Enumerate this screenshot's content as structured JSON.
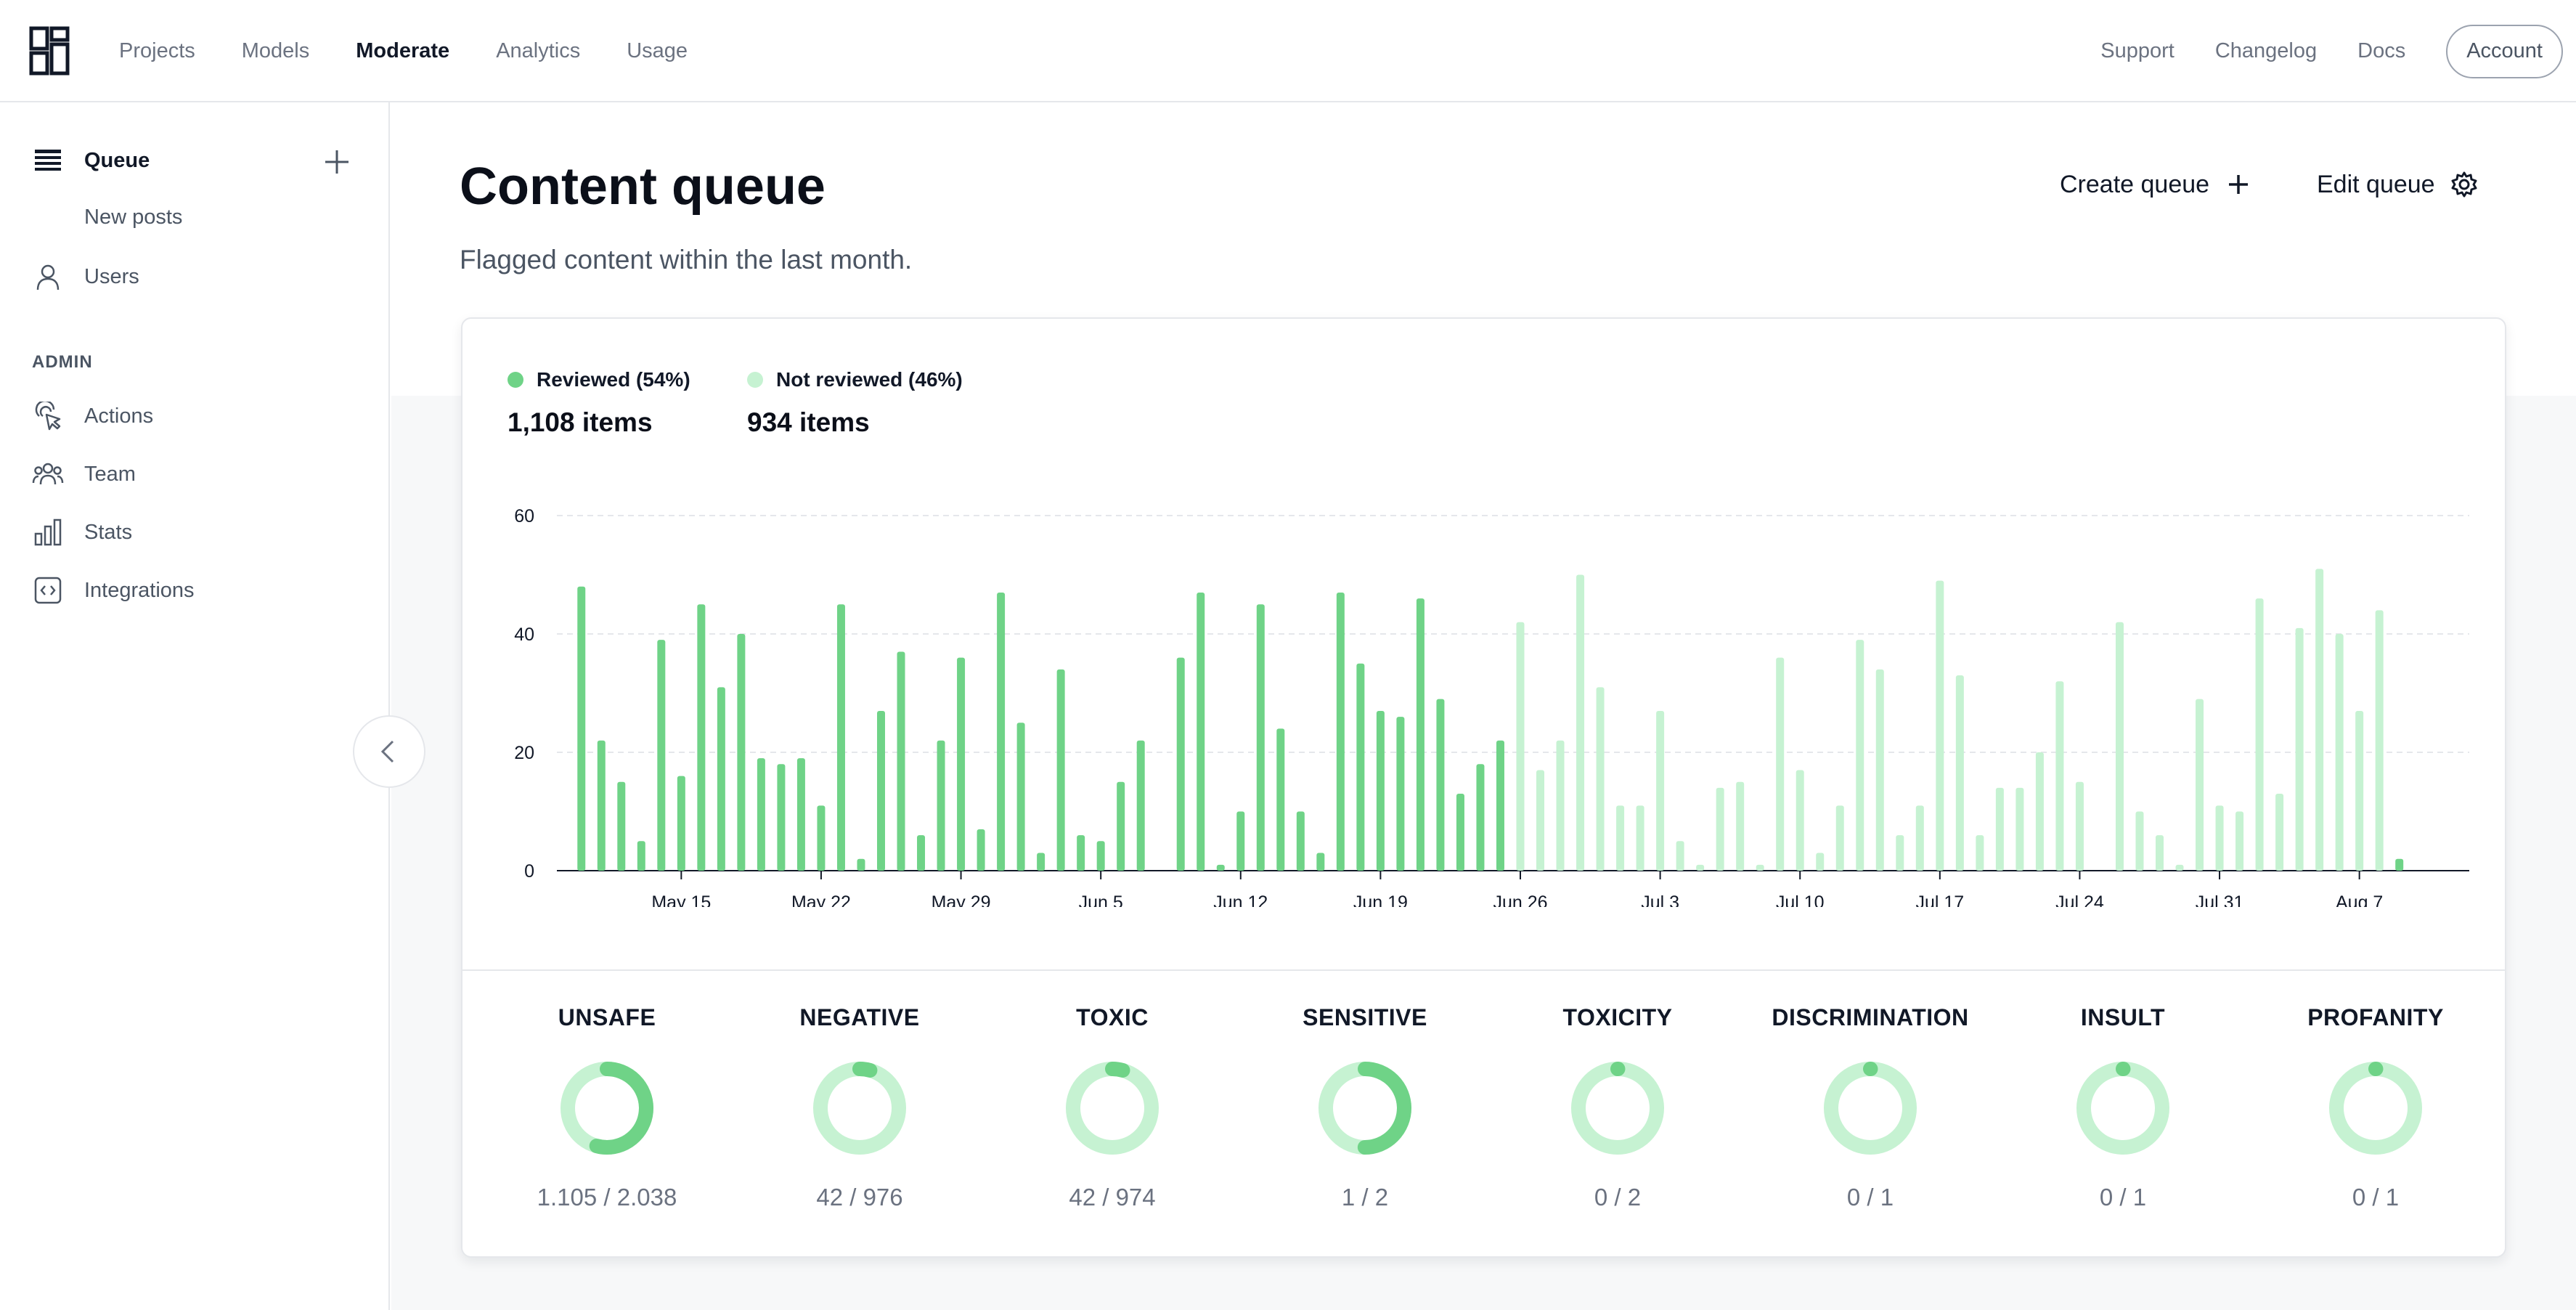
{
  "nav": {
    "items": [
      {
        "label": "Projects",
        "active": false
      },
      {
        "label": "Models",
        "active": false
      },
      {
        "label": "Moderate",
        "active": true
      },
      {
        "label": "Analytics",
        "active": false
      },
      {
        "label": "Usage",
        "active": false
      }
    ],
    "right": [
      "Support",
      "Changelog",
      "Docs"
    ],
    "account_label": "Account"
  },
  "sidebar": {
    "queue": {
      "label": "Queue",
      "icon": "list-icon"
    },
    "new_posts": "New posts",
    "users": {
      "label": "Users",
      "icon": "user-icon"
    },
    "section_admin": "ADMIN",
    "admin_items": [
      {
        "label": "Actions",
        "icon": "cursor-click-icon"
      },
      {
        "label": "Team",
        "icon": "team-icon"
      },
      {
        "label": "Stats",
        "icon": "bar-chart-icon"
      },
      {
        "label": "Integrations",
        "icon": "code-icon"
      }
    ]
  },
  "header": {
    "title": "Content queue",
    "subtitle": "Flagged content within the last month.",
    "create_queue": "Create queue",
    "edit_queue": "Edit queue"
  },
  "legend": {
    "reviewed": {
      "label": "Reviewed (54%)",
      "count": "1,108 items",
      "color": "#6fd387"
    },
    "not_reviewed": {
      "label": "Not reviewed (46%)",
      "count": "934 items",
      "color": "#c6f2d2"
    }
  },
  "chart_data": {
    "type": "bar",
    "ylim": [
      0,
      60
    ],
    "yticks": [
      0,
      20,
      40,
      60
    ],
    "grid": true,
    "x_start": "May 10",
    "xtick_labels": [
      "May 15",
      "May 22",
      "May 29",
      "Jun 5",
      "Jun 12",
      "Jun 19",
      "Jun 26",
      "Jul 3",
      "Jul 10",
      "Jul 17",
      "Jul 24",
      "Jul 31",
      "Aug 7"
    ],
    "series": [
      {
        "name": "Reviewed",
        "color": "#6fd387",
        "values": [
          48,
          22,
          15,
          5,
          39,
          16,
          45,
          31,
          40,
          19,
          18,
          19,
          11,
          45,
          2,
          27,
          37,
          6,
          22,
          36,
          7,
          47,
          25,
          3,
          34,
          6,
          5,
          15,
          22,
          0,
          36,
          47,
          1,
          10,
          45,
          24,
          10,
          3,
          47,
          35,
          27,
          26,
          46,
          29,
          13,
          18,
          22,
          0,
          0,
          0,
          0,
          0,
          0,
          0,
          0,
          0,
          0,
          0,
          0,
          0,
          0,
          0,
          0,
          0,
          0,
          0,
          0,
          0,
          0,
          0,
          0,
          0,
          0,
          0,
          0,
          0,
          0,
          0,
          0,
          0,
          0,
          0,
          0,
          0,
          0,
          0,
          0,
          0,
          0,
          0,
          0,
          2,
          0,
          0,
          0
        ]
      },
      {
        "name": "Not reviewed",
        "color": "#c6f2d2",
        "values": [
          0,
          0,
          0,
          0,
          0,
          0,
          0,
          0,
          0,
          0,
          0,
          0,
          0,
          0,
          0,
          0,
          0,
          0,
          0,
          0,
          0,
          0,
          0,
          0,
          0,
          0,
          0,
          0,
          0,
          0,
          0,
          0,
          0,
          0,
          0,
          0,
          0,
          0,
          0,
          0,
          0,
          0,
          0,
          0,
          0,
          0,
          0,
          42,
          17,
          22,
          50,
          31,
          11,
          11,
          27,
          5,
          1,
          14,
          15,
          1,
          36,
          17,
          3,
          11,
          39,
          34,
          6,
          11,
          49,
          33,
          6,
          14,
          14,
          20,
          32,
          15,
          0,
          42,
          10,
          6,
          1,
          29,
          11,
          10,
          46,
          13,
          41,
          51,
          40,
          27,
          44,
          0,
          0,
          0,
          0
        ]
      }
    ]
  },
  "categories": [
    {
      "name": "UNSAFE",
      "reviewed": 1105,
      "total": 2038,
      "ratio": "1.105 / 2.038"
    },
    {
      "name": "NEGATIVE",
      "reviewed": 42,
      "total": 976,
      "ratio": "42 / 976"
    },
    {
      "name": "TOXIC",
      "reviewed": 42,
      "total": 974,
      "ratio": "42 / 974"
    },
    {
      "name": "SENSITIVE",
      "reviewed": 1,
      "total": 2,
      "ratio": "1 / 2"
    },
    {
      "name": "TOXICITY",
      "reviewed": 0,
      "total": 2,
      "ratio": "0 / 2"
    },
    {
      "name": "DISCRIMINATION",
      "reviewed": 0,
      "total": 1,
      "ratio": "0 / 1"
    },
    {
      "name": "INSULT",
      "reviewed": 0,
      "total": 1,
      "ratio": "0 / 1"
    },
    {
      "name": "PROFANITY",
      "reviewed": 0,
      "total": 1,
      "ratio": "0 / 1"
    }
  ],
  "colors": {
    "reviewed": "#6fd387",
    "not_reviewed": "#c6f2d2"
  }
}
